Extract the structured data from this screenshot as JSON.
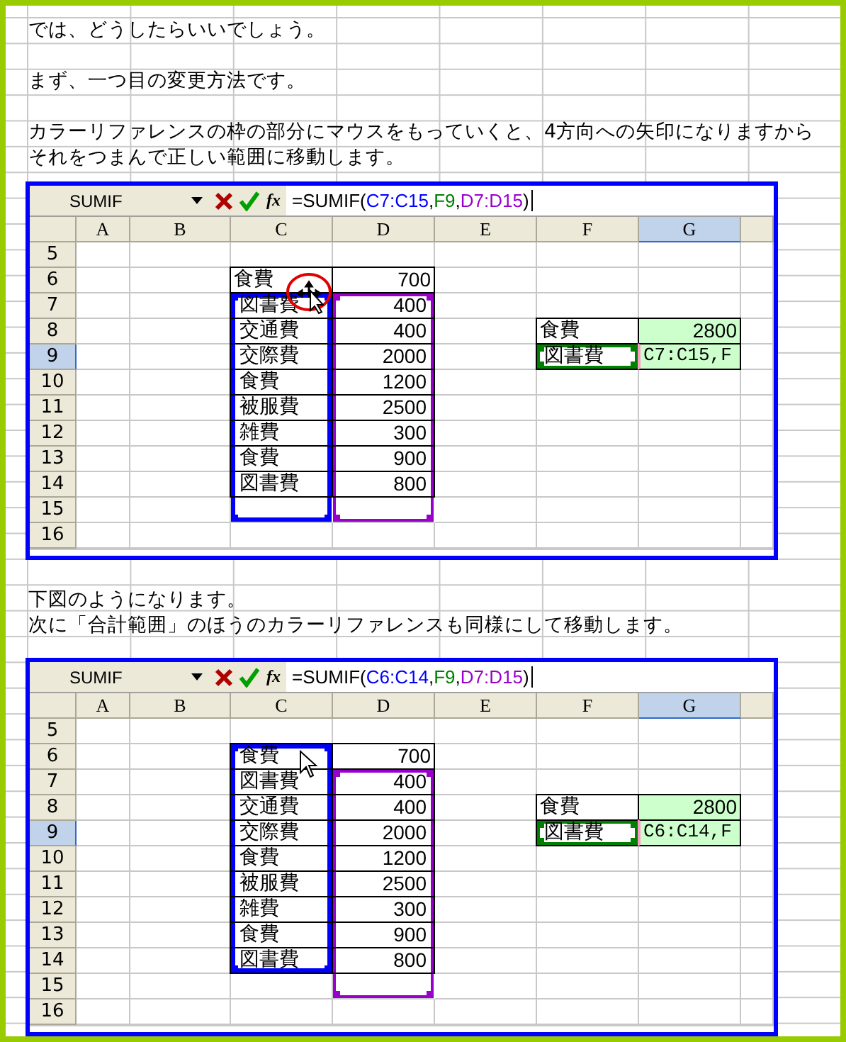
{
  "sections": [
    {
      "kind": "text",
      "paragraphs": [
        [
          "では、どうしたらいいでしょう。"
        ],
        [
          "まず、一つ目の変更方法です。"
        ],
        [
          "カラーリファレンスの枠の部分にマウスをもっていくと、4方向への矢印になりますから",
          "それをつまんで正しい範囲に移動します。"
        ]
      ]
    },
    {
      "kind": "sheet",
      "name_box": "SUMIF",
      "function_button": "fx",
      "formula": [
        {
          "text": "=SUMIF("
        },
        {
          "text": "C7:C15",
          "color": "#0000ff"
        },
        {
          "text": ","
        },
        {
          "text": "F9",
          "color": "#008000"
        },
        {
          "text": ","
        },
        {
          "text": "D7:D15",
          "color": "#9900cc"
        },
        {
          "text": ")"
        }
      ],
      "columns": [
        {
          "label": "A",
          "selected": false
        },
        {
          "label": "B",
          "selected": false
        },
        {
          "label": "C",
          "selected": false
        },
        {
          "label": "D",
          "selected": false
        },
        {
          "label": "E",
          "selected": false
        },
        {
          "label": "F",
          "selected": false
        },
        {
          "label": "G",
          "selected": true
        }
      ],
      "rows": [
        {
          "label": "5",
          "selected": false,
          "cells": [
            {},
            {},
            {},
            {},
            {},
            {},
            {}
          ]
        },
        {
          "label": "6",
          "selected": false,
          "cells": [
            {},
            {},
            {
              "kind": "label",
              "text": "食費"
            },
            {
              "kind": "number",
              "text": "700"
            },
            {},
            {},
            {}
          ]
        },
        {
          "label": "7",
          "selected": false,
          "cells": [
            {},
            {},
            {
              "kind": "label",
              "text": "図書費",
              "outline": {
                "color": "#0000ff"
              },
              "cursor": {
                "kind": "move"
              }
            },
            {
              "kind": "number",
              "text": "400",
              "outline": {
                "color": "#9900cc"
              }
            },
            {},
            {},
            {}
          ]
        },
        {
          "label": "8",
          "selected": false,
          "cells": [
            {},
            {},
            {
              "kind": "label",
              "text": "交通費",
              "outline": {
                "color": "#0000ff"
              }
            },
            {
              "kind": "number",
              "text": "400",
              "outline": {
                "color": "#9900cc"
              }
            },
            {},
            {
              "kind": "label",
              "text": "食費"
            },
            {
              "kind": "result",
              "text": "2800"
            }
          ]
        },
        {
          "label": "9",
          "selected": true,
          "cells": [
            {},
            {},
            {
              "kind": "label",
              "text": "交際費",
              "outline": {
                "color": "#0000ff"
              }
            },
            {
              "kind": "number",
              "text": "2000",
              "outline": {
                "color": "#9900cc"
              }
            },
            {},
            {
              "kind": "label",
              "text": "図書費",
              "outline": {
                "color": "#008000"
              }
            },
            {
              "kind": "editing",
              "text": "C7:C15,F"
            }
          ]
        },
        {
          "label": "10",
          "selected": false,
          "cells": [
            {},
            {},
            {
              "kind": "label",
              "text": "食費",
              "outline": {
                "color": "#0000ff"
              }
            },
            {
              "kind": "number",
              "text": "1200",
              "outline": {
                "color": "#9900cc"
              }
            },
            {},
            {},
            {}
          ]
        },
        {
          "label": "11",
          "selected": false,
          "cells": [
            {},
            {},
            {
              "kind": "label",
              "text": "被服費",
              "outline": {
                "color": "#0000ff"
              }
            },
            {
              "kind": "number",
              "text": "2500",
              "outline": {
                "color": "#9900cc"
              }
            },
            {},
            {},
            {}
          ]
        },
        {
          "label": "12",
          "selected": false,
          "cells": [
            {},
            {},
            {
              "kind": "label",
              "text": "雑費",
              "outline": {
                "color": "#0000ff"
              }
            },
            {
              "kind": "number",
              "text": "300",
              "outline": {
                "color": "#9900cc"
              }
            },
            {},
            {},
            {}
          ]
        },
        {
          "label": "13",
          "selected": false,
          "cells": [
            {},
            {},
            {
              "kind": "label",
              "text": "食費",
              "outline": {
                "color": "#0000ff"
              }
            },
            {
              "kind": "number",
              "text": "900",
              "outline": {
                "color": "#9900cc"
              }
            },
            {},
            {},
            {}
          ]
        },
        {
          "label": "14",
          "selected": false,
          "cells": [
            {},
            {},
            {
              "kind": "label",
              "text": "図書費",
              "outline": {
                "color": "#0000ff"
              }
            },
            {
              "kind": "number",
              "text": "800",
              "outline": {
                "color": "#9900cc"
              }
            },
            {},
            {},
            {}
          ]
        },
        {
          "label": "15",
          "selected": false,
          "cells": [
            {},
            {},
            {
              "outline": {
                "color": "#0000ff"
              }
            },
            {
              "outline": {
                "color": "#9900cc"
              }
            },
            {},
            {},
            {}
          ]
        },
        {
          "label": "16",
          "selected": false,
          "cells": [
            {},
            {},
            {},
            {},
            {},
            {},
            {}
          ]
        }
      ]
    },
    {
      "kind": "text",
      "paragraphs": [
        [
          "下図のようになります。",
          "次に「合計範囲」のほうのカラーリファレンスも同様にして移動します。"
        ]
      ]
    },
    {
      "kind": "sheet",
      "name_box": "SUMIF",
      "function_button": "fx",
      "formula": [
        {
          "text": "=SUMIF("
        },
        {
          "text": "C6:C14",
          "color": "#0000ff"
        },
        {
          "text": ","
        },
        {
          "text": "F9",
          "color": "#008000"
        },
        {
          "text": ","
        },
        {
          "text": "D7:D15",
          "color": "#9900cc"
        },
        {
          "text": ")"
        }
      ],
      "columns": [
        {
          "label": "A",
          "selected": false
        },
        {
          "label": "B",
          "selected": false
        },
        {
          "label": "C",
          "selected": false
        },
        {
          "label": "D",
          "selected": false
        },
        {
          "label": "E",
          "selected": false
        },
        {
          "label": "F",
          "selected": false
        },
        {
          "label": "G",
          "selected": true
        }
      ],
      "rows": [
        {
          "label": "5",
          "selected": false,
          "cells": [
            {},
            {},
            {},
            {},
            {},
            {},
            {}
          ]
        },
        {
          "label": "6",
          "selected": false,
          "cells": [
            {},
            {},
            {
              "kind": "label",
              "text": "食費",
              "outline": {
                "color": "#0000ff"
              },
              "cursor": {
                "kind": "arrow"
              }
            },
            {
              "kind": "number",
              "text": "700"
            },
            {},
            {},
            {}
          ]
        },
        {
          "label": "7",
          "selected": false,
          "cells": [
            {},
            {},
            {
              "kind": "label",
              "text": "図書費",
              "outline": {
                "color": "#0000ff"
              }
            },
            {
              "kind": "number",
              "text": "400",
              "outline": {
                "color": "#9900cc"
              }
            },
            {},
            {},
            {}
          ]
        },
        {
          "label": "8",
          "selected": false,
          "cells": [
            {},
            {},
            {
              "kind": "label",
              "text": "交通費",
              "outline": {
                "color": "#0000ff"
              }
            },
            {
              "kind": "number",
              "text": "400",
              "outline": {
                "color": "#9900cc"
              }
            },
            {},
            {
              "kind": "label",
              "text": "食費"
            },
            {
              "kind": "result",
              "text": "2800"
            }
          ]
        },
        {
          "label": "9",
          "selected": true,
          "cells": [
            {},
            {},
            {
              "kind": "label",
              "text": "交際費",
              "outline": {
                "color": "#0000ff"
              }
            },
            {
              "kind": "number",
              "text": "2000",
              "outline": {
                "color": "#9900cc"
              }
            },
            {},
            {
              "kind": "label",
              "text": "図書費",
              "outline": {
                "color": "#008000"
              }
            },
            {
              "kind": "editing",
              "text": "C6:C14,F"
            }
          ]
        },
        {
          "label": "10",
          "selected": false,
          "cells": [
            {},
            {},
            {
              "kind": "label",
              "text": "食費",
              "outline": {
                "color": "#0000ff"
              }
            },
            {
              "kind": "number",
              "text": "1200",
              "outline": {
                "color": "#9900cc"
              }
            },
            {},
            {},
            {}
          ]
        },
        {
          "label": "11",
          "selected": false,
          "cells": [
            {},
            {},
            {
              "kind": "label",
              "text": "被服費",
              "outline": {
                "color": "#0000ff"
              }
            },
            {
              "kind": "number",
              "text": "2500",
              "outline": {
                "color": "#9900cc"
              }
            },
            {},
            {},
            {}
          ]
        },
        {
          "label": "12",
          "selected": false,
          "cells": [
            {},
            {},
            {
              "kind": "label",
              "text": "雑費",
              "outline": {
                "color": "#0000ff"
              }
            },
            {
              "kind": "number",
              "text": "300",
              "outline": {
                "color": "#9900cc"
              }
            },
            {},
            {},
            {}
          ]
        },
        {
          "label": "13",
          "selected": false,
          "cells": [
            {},
            {},
            {
              "kind": "label",
              "text": "食費",
              "outline": {
                "color": "#0000ff"
              }
            },
            {
              "kind": "number",
              "text": "900",
              "outline": {
                "color": "#9900cc"
              }
            },
            {},
            {},
            {}
          ]
        },
        {
          "label": "14",
          "selected": false,
          "cells": [
            {},
            {},
            {
              "kind": "label",
              "text": "図書費",
              "outline": {
                "color": "#0000ff"
              }
            },
            {
              "kind": "number",
              "text": "800",
              "outline": {
                "color": "#9900cc"
              }
            },
            {},
            {},
            {}
          ]
        },
        {
          "label": "15",
          "selected": false,
          "cells": [
            {},
            {},
            {},
            {
              "outline": {
                "color": "#9900cc"
              }
            },
            {},
            {},
            {}
          ]
        },
        {
          "label": "16",
          "selected": false,
          "cells": [
            {},
            {},
            {},
            {},
            {},
            {},
            {}
          ]
        }
      ]
    }
  ]
}
